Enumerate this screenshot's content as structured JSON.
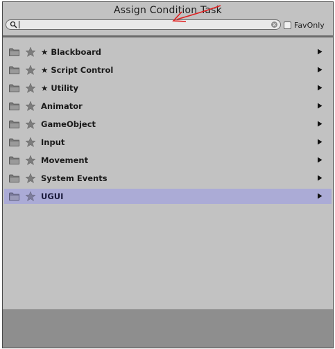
{
  "window": {
    "title": "Assign Condition Task"
  },
  "search": {
    "value": "",
    "placeholder": "",
    "icon": "search-icon",
    "clear_icon": "clear-icon"
  },
  "favonly": {
    "label": "FavOnly",
    "checked": false
  },
  "categories": [
    {
      "label": "★ Blackboard",
      "selected": false
    },
    {
      "label": "★ Script Control",
      "selected": false
    },
    {
      "label": "★ Utility",
      "selected": false
    },
    {
      "label": "Animator",
      "selected": false
    },
    {
      "label": "GameObject",
      "selected": false
    },
    {
      "label": "Input",
      "selected": false
    },
    {
      "label": "Movement",
      "selected": false
    },
    {
      "label": "System Events",
      "selected": false
    },
    {
      "label": "UGUI",
      "selected": true
    }
  ],
  "icons": {
    "row_folder": "folder-icon",
    "row_favorite": "star-icon",
    "row_submenu": "chevron-right-icon"
  },
  "colors": {
    "panel_bg": "#c2c2c2",
    "selected_row": "#ababd6",
    "footer_bg": "#8e8e8e",
    "annotation": "#e02020"
  }
}
